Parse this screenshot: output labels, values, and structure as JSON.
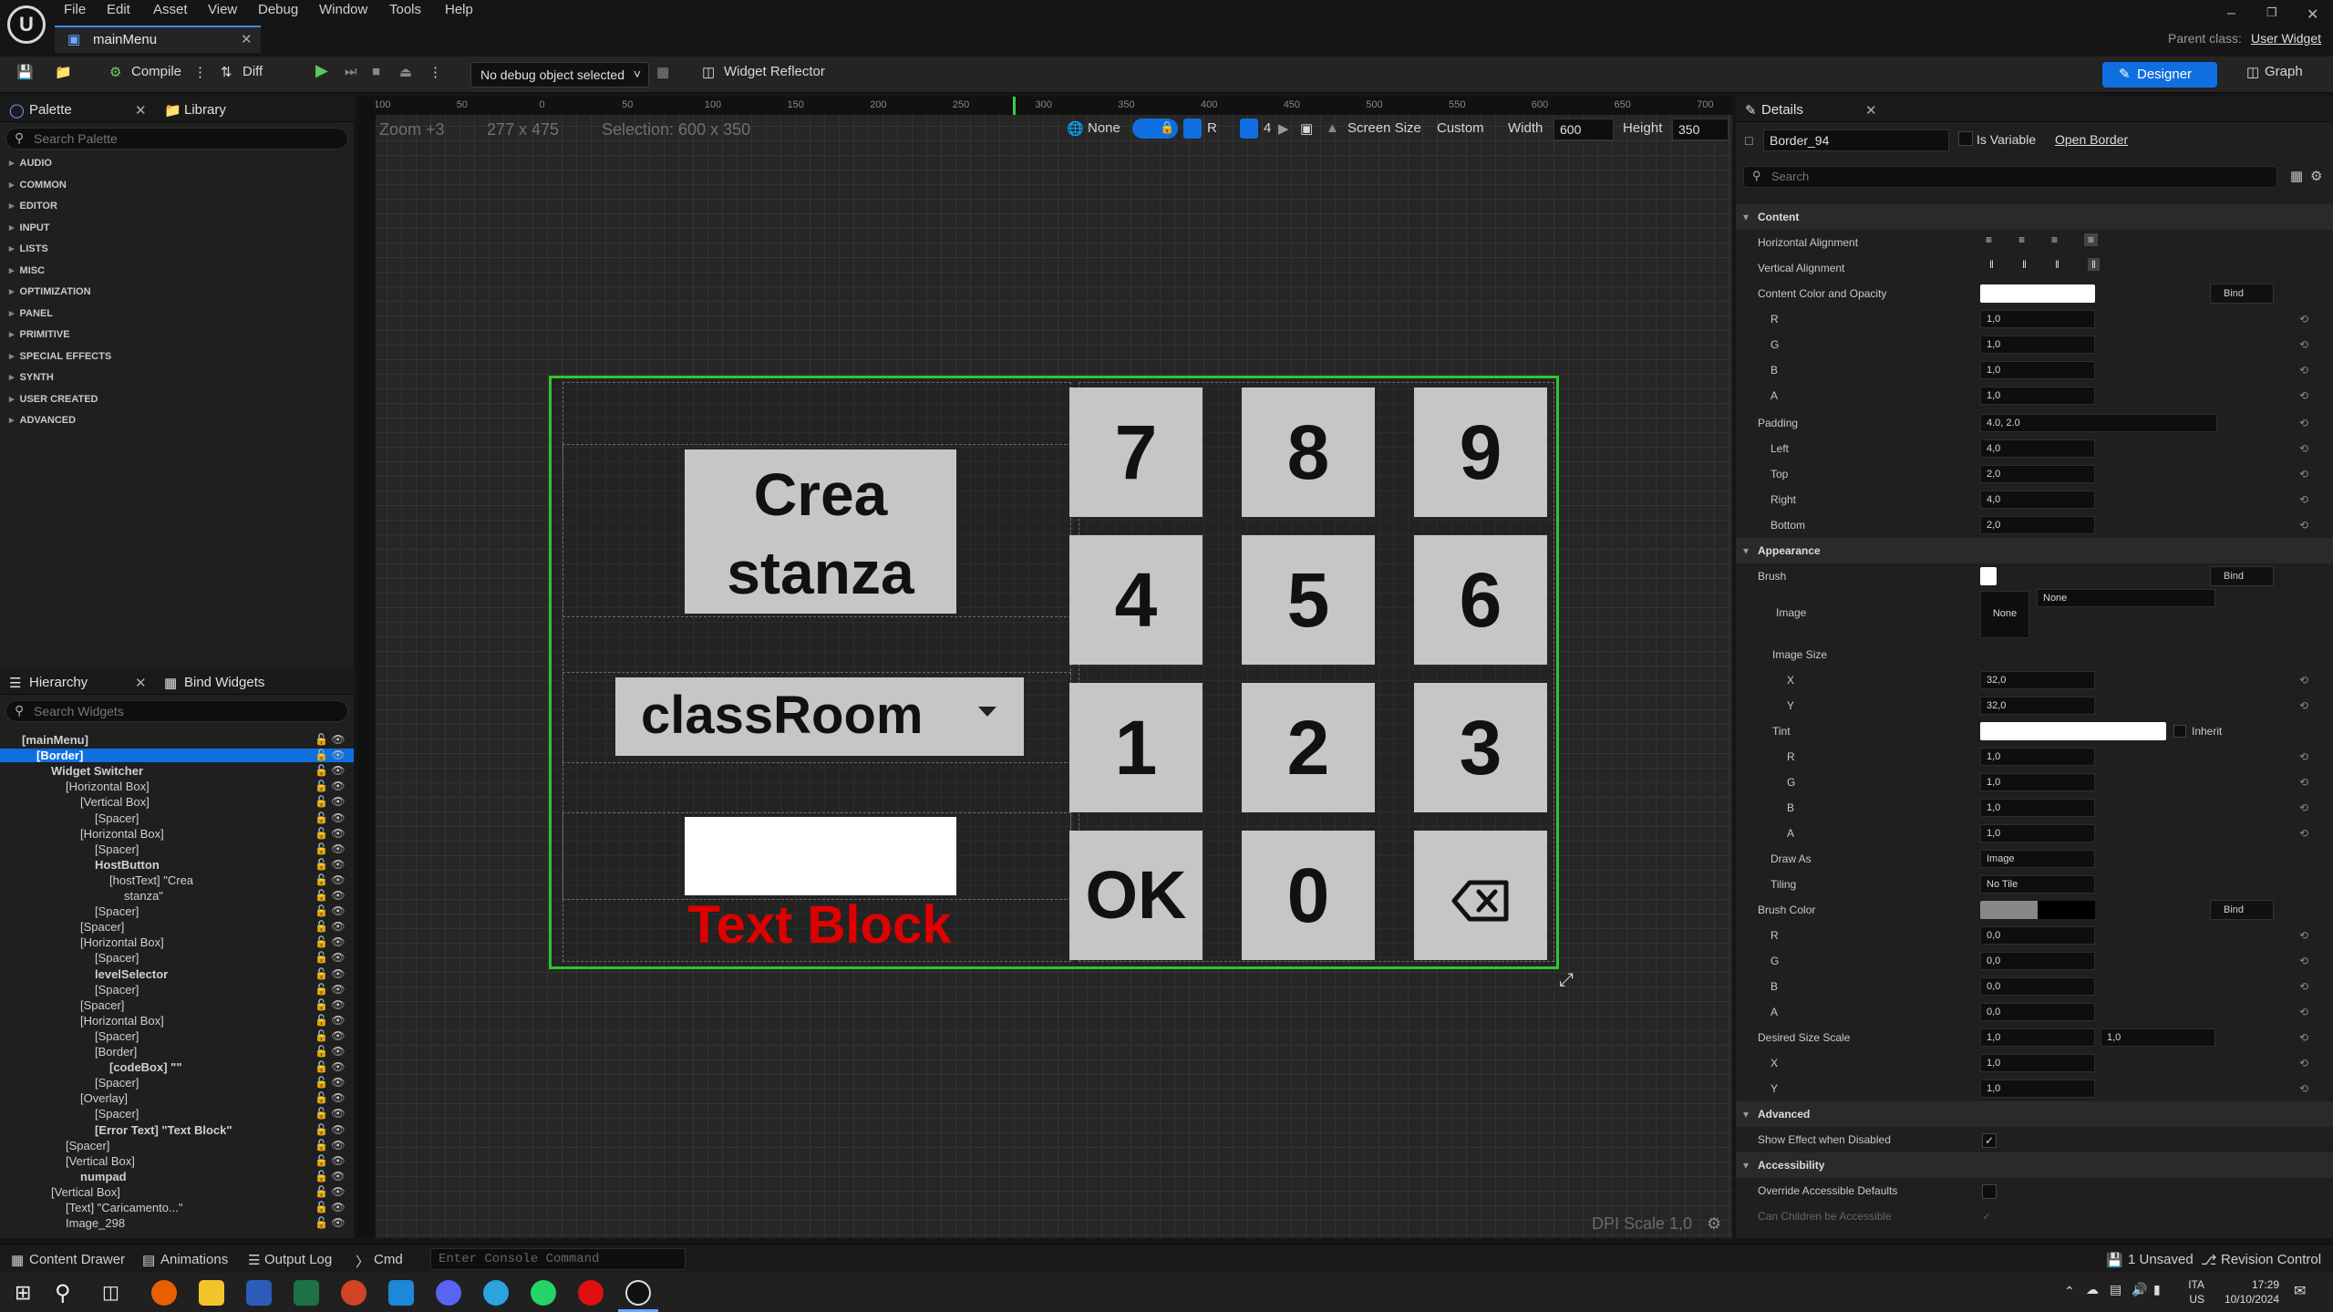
{
  "app": {
    "menus": [
      "File",
      "Edit",
      "Asset",
      "View",
      "Debug",
      "Window",
      "Tools",
      "Help"
    ],
    "document_tab": "mainMenu",
    "parent_class_label": "Parent class:",
    "parent_class_value": "User Widget"
  },
  "toolbar": {
    "compile": "Compile",
    "diff": "Diff",
    "debug_object": "No debug object selected",
    "widget_reflector": "Widget Reflector",
    "designer": "Designer",
    "graph": "Graph"
  },
  "palette": {
    "tab": "Palette",
    "library_tab": "Library",
    "search_placeholder": "Search Palette",
    "categories": [
      "AUDIO",
      "COMMON",
      "EDITOR",
      "INPUT",
      "LISTS",
      "MISC",
      "OPTIMIZATION",
      "PANEL",
      "PRIMITIVE",
      "SPECIAL EFFECTS",
      "SYNTH",
      "USER CREATED",
      "ADVANCED"
    ]
  },
  "hierarchy": {
    "tab": "Hierarchy",
    "bind_tab": "Bind Widgets",
    "search_placeholder": "Search Widgets",
    "rows": [
      "[mainMenu]",
      "[Border]",
      "Widget Switcher",
      "[Horizontal Box]",
      "[Vertical Box]",
      "[Spacer]",
      "[Horizontal Box]",
      "[Spacer]",
      "HostButton",
      "[hostText] \"Crea",
      "stanza\"",
      "[Spacer]",
      "[Spacer]",
      "[Horizontal Box]",
      "[Spacer]",
      "levelSelector",
      "[Spacer]",
      "[Spacer]",
      "[Horizontal Box]",
      "[Spacer]",
      "[Border]",
      "[codeBox] \"\"",
      "[Spacer]",
      "[Overlay]",
      "[Spacer]",
      "[Error Text] \"Text Block\"",
      "[Spacer]",
      "[Vertical Box]",
      "numpad",
      "[Vertical Box]",
      "[Text] \"Caricamento...\"",
      "Image_298"
    ]
  },
  "viewport": {
    "zoom": "Zoom +3",
    "size": "277 x 475",
    "selection": "Selection: 600 x 350",
    "none_label": "None",
    "r_label": "R",
    "grid_count": "4",
    "screen_size": "Screen Size",
    "custom": "Custom",
    "width_label": "Width",
    "width_value": "600",
    "height_label": "Height",
    "height_value": "350",
    "dpi_scale": "DPI Scale 1,0",
    "ruler_ticks": [
      "100",
      "50",
      "0",
      "50",
      "100",
      "150",
      "200",
      "250",
      "300",
      "350",
      "400",
      "450",
      "500",
      "550",
      "600",
      "650",
      "700"
    ]
  },
  "widget": {
    "create_button": "Crea stanza",
    "create_line1": "Crea",
    "create_line2": "stanza",
    "combo_value": "classRoom",
    "error_text": "Text Block",
    "keys": [
      "7",
      "8",
      "9",
      "4",
      "5",
      "6",
      "1",
      "2",
      "3",
      "OK",
      "0"
    ]
  },
  "details": {
    "tab": "Details",
    "object_name": "Border_94",
    "is_variable": "Is Variable",
    "open_border": "Open Border",
    "search_placeholder": "Search",
    "sections": {
      "content": "Content",
      "appearance": "Appearance",
      "advanced": "Advanced",
      "accessibility": "Accessibility"
    },
    "labels": {
      "h_align": "Horizontal Alignment",
      "v_align": "Vertical Alignment",
      "content_color": "Content Color and Opacity",
      "r": "R",
      "g": "G",
      "b": "B",
      "a": "A",
      "padding": "Padding",
      "left": "Left",
      "top": "Top",
      "right": "Right",
      "bottom": "Bottom",
      "brush": "Brush",
      "image": "Image",
      "image_size": "Image Size",
      "x": "X",
      "y": "Y",
      "tint": "Tint",
      "inherit": "Inherit",
      "draw_as": "Draw As",
      "tiling": "Tiling",
      "brush_color": "Brush Color",
      "desired_size_scale": "Desired Size Scale",
      "show_effect": "Show Effect when Disabled",
      "override_accessible": "Override Accessible Defaults",
      "children_accessible": "Can Children be Accessible",
      "bind": "Bind"
    },
    "values": {
      "cc_r": "1,0",
      "cc_g": "1,0",
      "cc_b": "1,0",
      "cc_a": "1,0",
      "padding": "4.0, 2.0",
      "pad_left": "4,0",
      "pad_top": "2,0",
      "pad_right": "4,0",
      "pad_bottom": "2,0",
      "image_none": "None",
      "image_dropdown": "None",
      "size_x": "32,0",
      "size_y": "32,0",
      "tint_r": "1,0",
      "tint_g": "1,0",
      "tint_b": "1,0",
      "tint_a": "1,0",
      "draw_as": "Image",
      "tiling": "No Tile",
      "bc_r": "0,0",
      "bc_g": "0,0",
      "bc_b": "0,0",
      "bc_a": "0,0",
      "dss_1": "1,0",
      "dss_2": "1,0",
      "dss_x": "1,0",
      "dss_y": "1,0"
    }
  },
  "statusbar": {
    "content_drawer": "Content Drawer",
    "animations": "Animations",
    "output_log": "Output Log",
    "cmd": "Cmd",
    "console_placeholder": "Enter Console Command",
    "unsaved": "1 Unsaved",
    "revision_control": "Revision Control"
  },
  "taskbar": {
    "lang1": "ITA",
    "lang2": "US",
    "time": "17:29",
    "date": "10/10/2024"
  },
  "colors": {
    "accent_blue": "#0f6fe0",
    "selection_green": "#2fc62f",
    "error_red": "#e00000",
    "button_grey": "#c6c6c6"
  }
}
